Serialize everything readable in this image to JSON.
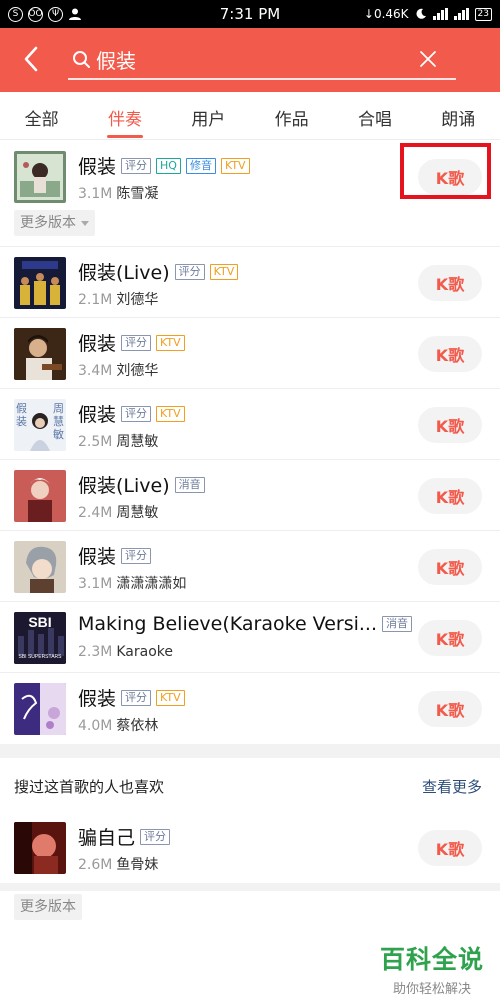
{
  "status_bar": {
    "time": "7:31 PM",
    "left_icons": [
      "S",
      "OO",
      "Ψ"
    ],
    "net_speed": "↓0.46K",
    "battery": "23"
  },
  "header": {
    "search_query": "假装"
  },
  "tabs": [
    {
      "label": "全部",
      "active": false
    },
    {
      "label": "伴奏",
      "active": true
    },
    {
      "label": "用户",
      "active": false
    },
    {
      "label": "作品",
      "active": false
    },
    {
      "label": "合唱",
      "active": false
    },
    {
      "label": "朗诵",
      "active": false
    }
  ],
  "sing_label": "K歌",
  "more_versions_label": "更多版本",
  "songs": [
    {
      "title": "假装",
      "tags": [
        {
          "text": "评分",
          "kind": "score"
        },
        {
          "text": "HQ",
          "kind": "hq"
        },
        {
          "text": "修音",
          "kind": "remix"
        },
        {
          "text": "KTV",
          "kind": "ktv"
        }
      ],
      "plays": "3.1M",
      "artist": "陈雪凝"
    },
    {
      "title": "假装(Live)",
      "tags": [
        {
          "text": "评分",
          "kind": "score"
        },
        {
          "text": "KTV",
          "kind": "ktv"
        }
      ],
      "plays": "2.1M",
      "artist": "刘德华"
    },
    {
      "title": "假装",
      "tags": [
        {
          "text": "评分",
          "kind": "score"
        },
        {
          "text": "KTV",
          "kind": "ktv"
        }
      ],
      "plays": "3.4M",
      "artist": "刘德华"
    },
    {
      "title": "假装",
      "tags": [
        {
          "text": "评分",
          "kind": "score"
        },
        {
          "text": "KTV",
          "kind": "ktv"
        }
      ],
      "plays": "2.5M",
      "artist": "周慧敏"
    },
    {
      "title": "假装(Live)",
      "tags": [
        {
          "text": "消音",
          "kind": "mute"
        }
      ],
      "plays": "2.4M",
      "artist": "周慧敏"
    },
    {
      "title": "假装",
      "tags": [
        {
          "text": "评分",
          "kind": "score"
        }
      ],
      "plays": "3.1M",
      "artist": "潇潇潇潇如"
    },
    {
      "title": "Making Believe(Karaoke Versi...",
      "tags": [
        {
          "text": "消音",
          "kind": "mute"
        }
      ],
      "plays": "2.3M",
      "artist": "Karaoke"
    },
    {
      "title": "假装",
      "tags": [
        {
          "text": "评分",
          "kind": "score"
        },
        {
          "text": "KTV",
          "kind": "ktv"
        }
      ],
      "plays": "4.0M",
      "artist": "蔡依林"
    }
  ],
  "covers": {
    "c0": {
      "text": ""
    },
    "c1": {
      "text": ""
    },
    "c2": {
      "text": ""
    },
    "c3": {
      "chars": [
        "假",
        "周",
        "装",
        "慧",
        "敏"
      ]
    },
    "c4": {
      "text": ""
    },
    "c5": {
      "text": ""
    },
    "c6": {
      "text": "SBI",
      "sub": "SBI SUPERSTARS"
    },
    "c7": {
      "text": ""
    }
  },
  "related": {
    "title": "搜过这首歌的人也喜欢",
    "more": "查看更多",
    "song": {
      "title": "骗自己",
      "tags": [
        {
          "text": "评分",
          "kind": "score"
        }
      ],
      "plays": "2.6M",
      "artist": "鱼骨妹"
    }
  },
  "watermark": {
    "main": "百科全说",
    "sub": "助你轻松解决"
  },
  "colors": {
    "accent": "#f25a4b",
    "highlight_box": "#e4131e",
    "watermark": "#2fa24d"
  }
}
